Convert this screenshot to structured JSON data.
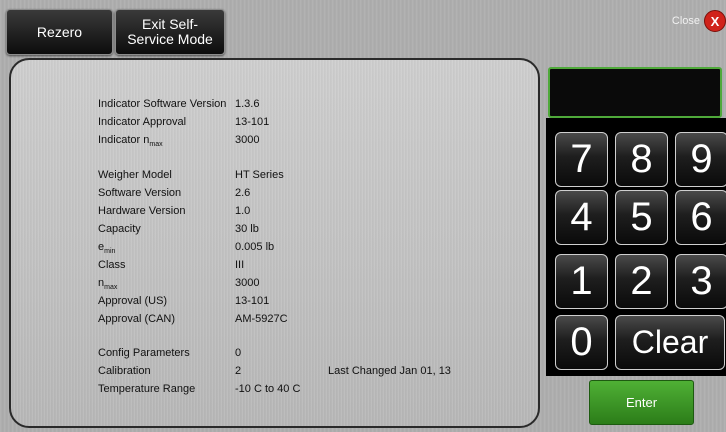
{
  "toolbar": {
    "rezero_label": "Rezero",
    "exit_line1": "Exit Self-",
    "exit_line2": "Service Mode",
    "close_label": "Close",
    "close_icon": "X"
  },
  "info": {
    "rows": [
      {
        "label": "Indicator Software Version",
        "value": "1.3.6"
      },
      {
        "label": "Indicator Approval",
        "value": "13-101"
      },
      {
        "label": "Indicator n",
        "label_sub": "max",
        "value": "3000"
      },
      {
        "label": "Weigher Model",
        "value": "HT Series"
      },
      {
        "label": "Software Version",
        "value": "2.6"
      },
      {
        "label": "Hardware Version",
        "value": "1.0"
      },
      {
        "label": "Capacity",
        "value": "30 lb"
      },
      {
        "label": "e",
        "label_sub": "min",
        "value": "0.005 lb"
      },
      {
        "label": "Class",
        "value": "III"
      },
      {
        "label": "n",
        "label_sub": "max",
        "value": "3000"
      },
      {
        "label": "Approval (US)",
        "value": "13-101"
      },
      {
        "label": "Approval (CAN)",
        "value": "AM-5927C"
      },
      {
        "label": "Config Parameters",
        "value": "0"
      },
      {
        "label": "Calibration",
        "value": "2",
        "extra": "Last Changed Jan 01, 13"
      },
      {
        "label": "Temperature Range",
        "value": "-10 C to 40 C"
      }
    ]
  },
  "keypad": {
    "display_value": "",
    "keys": [
      "7",
      "8",
      "9",
      "4",
      "5",
      "6",
      "1",
      "2",
      "3",
      "0"
    ],
    "clear_label": "Clear",
    "enter_label": "Enter"
  },
  "colors": {
    "enter_green": "#3a9a26",
    "display_border": "#4fa93a",
    "close_red": "#d0231b"
  }
}
